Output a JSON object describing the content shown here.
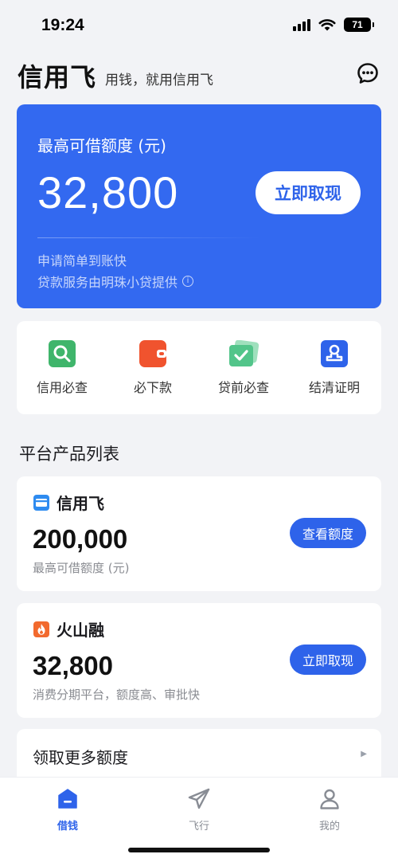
{
  "status_bar": {
    "time": "19:24",
    "battery": "71"
  },
  "header": {
    "logo": "信用飞",
    "slogan": "用钱，就用信用飞"
  },
  "hero": {
    "label": "最高可借额度 (元)",
    "amount": "32,800",
    "button": "立即取现",
    "line1": "申请简单到账快",
    "line2": "贷款服务由明珠小贷提供"
  },
  "tools": [
    {
      "label": "信用必查",
      "icon": "search-doc-icon",
      "color": "#3fb56b"
    },
    {
      "label": "必下款",
      "icon": "wallet-icon",
      "color": "#f0532e"
    },
    {
      "label": "贷前必查",
      "icon": "check-card-icon",
      "color": "#52c58a"
    },
    {
      "label": "结清证明",
      "icon": "stamp-icon",
      "color": "#2e63ea"
    }
  ],
  "section_title": "平台产品列表",
  "products": [
    {
      "name": "信用飞",
      "amount": "200,000",
      "desc": "最高可借额度 (元)",
      "button": "查看额度",
      "icon": "card-icon"
    },
    {
      "name": "火山融",
      "amount": "32,800",
      "desc": "消费分期平台，额度高、审批快",
      "button": "立即取现",
      "icon": "fire-icon"
    }
  ],
  "more": {
    "label": "领取更多额度"
  },
  "nav": [
    {
      "label": "借钱",
      "icon": "home-icon"
    },
    {
      "label": "飞行",
      "icon": "paper-plane-icon"
    },
    {
      "label": "我的",
      "icon": "user-icon"
    }
  ],
  "colors": {
    "primary": "#2e63ea",
    "hero_bg": "#3369f0",
    "page_bg": "#f2f3f6"
  }
}
